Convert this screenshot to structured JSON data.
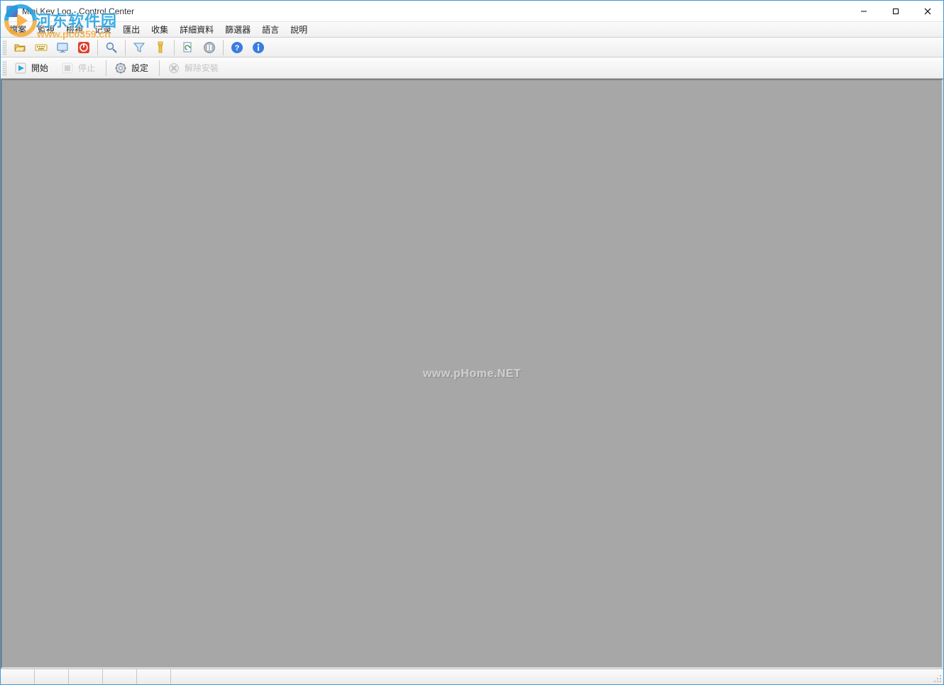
{
  "window": {
    "title": "Mini Key Log - Control Center"
  },
  "menu": {
    "items": [
      "檔案",
      "監視",
      "檢視",
      "记录",
      "匯出",
      "收集",
      "詳細資料",
      "篩選器",
      "語言",
      "說明"
    ]
  },
  "toolbar1_icons": [
    "open-icon",
    "keyboard-icon",
    "screen-icon",
    "power-icon",
    "sep",
    "search-icon",
    "sep",
    "filter-icon",
    "flashlight-icon",
    "sep",
    "refresh-doc-icon",
    "pause-icon",
    "sep",
    "help-icon",
    "info-icon"
  ],
  "toolbar2": {
    "start": "開始",
    "stop": "停止",
    "settings": "設定",
    "uninstall": "解除安裝"
  },
  "watermark": {
    "site_name": "河东软件园",
    "site_url": "www.pc0359.cn",
    "center": "www.pHome.NET"
  }
}
